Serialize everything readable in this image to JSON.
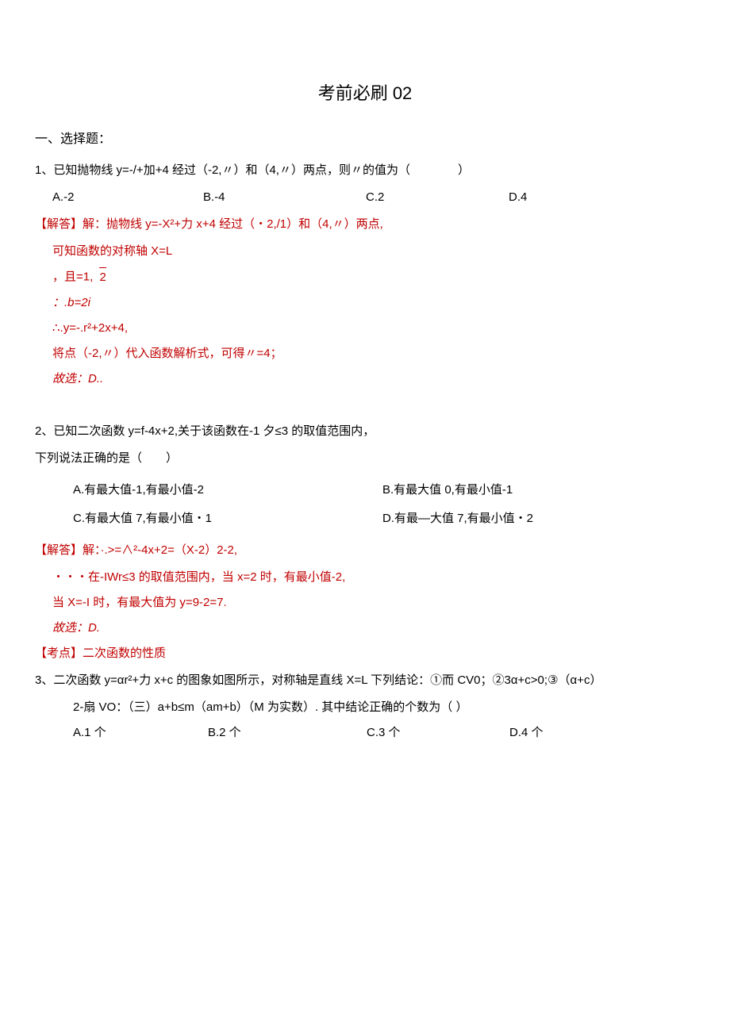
{
  "title": "考前必刷 02",
  "section1": "一、选择题：",
  "q1": {
    "stem": "1、已知抛物线 y=-/+加+4 经过（-2,〃）和（4,〃）两点，则〃的值为（　　　　）",
    "opts": {
      "A": "A.-2",
      "B": "B.-4",
      "C": "C.2",
      "D": "D.4"
    },
    "sol": {
      "l1": "【解答】解：抛物线 y=-X²+力 x+4 经过（・2,/1）和（4,〃）两点,",
      "l2": "可知函数的对称轴 X=L",
      "l3top": "，且=1,",
      "l3bot": "2",
      "l4": "：.b=2i",
      "l5": "∴.y=-.r²+2x+4,",
      "l6": "将点（-2,〃）代入函数解析式，可得〃=4；",
      "l7": "故选：D.."
    }
  },
  "q2": {
    "stemA": "2、已知二次函数 y=f-4x+2,关于该函数在-1 夕≤3 的取值范围内，",
    "stemB": "下列说法正确的是（　　）",
    "opts": {
      "A": "A.有最大值-1,有最小值-2",
      "B": "B.有最大值 0,有最小值-1",
      "C": "C.有最大值 7,有最小值・1",
      "D": "D.有最—大值 7,有最小值・2"
    },
    "sol": {
      "l1": "【解答】解：·.>=∧²-4x+2=（X-2）2-2,",
      "l2": "・・・在-IWr≤3 的取值范围内，当 x=2 时，有最小值-2,",
      "l3": "当 X=-I 时，有最大值为 y=9-2=7.",
      "l4": "故选：D."
    },
    "point": "【考点】二次函数的性质"
  },
  "q3": {
    "stem": "3、二次函数 y=αr²+力 x+c 的图象如图所示，对称轴是直线 X=L 下列结论：①而 CV0；②3α+c>0;③（α+c）",
    "l2": "2-扇 VO：（三）a+b≤m（am+b）（M 为实数）. 其中结论正确的个数为（ ）",
    "opts": {
      "A": "A.1 个",
      "B": "B.2 个",
      "C": "C.3 个",
      "D": "D.4 个"
    }
  }
}
